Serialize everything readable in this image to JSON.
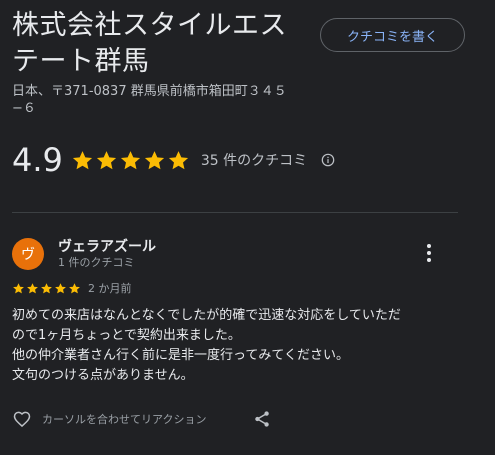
{
  "place": {
    "name_line1": "株式会社スタイルエス",
    "name_line2": "テート群馬",
    "address_line1": "日本、〒371-0837 群馬県前橋市箱田町３４５",
    "address_line2": "−６"
  },
  "write_review_button": {
    "label": "クチコミを書く"
  },
  "rating": {
    "value": "4.9",
    "stars": 5,
    "review_count_label": "35 件のクチコミ"
  },
  "review": {
    "avatar_initial": "ヴ",
    "avatar_color": "#e8710a",
    "author": "ヴェラアズール",
    "author_meta": "1 件のクチコミ",
    "stars": 5,
    "date": "2 か月前",
    "text_lines": [
      "初めての来店はなんとなくでしたが的確で迅速な対応をしていただ",
      "ので1ヶ月ちょっとで契約出来ました。",
      "他の仲介業者さん行く前に是非一度行ってみてください。",
      "文句のつける点がありません。"
    ],
    "reaction_label": "カーソルを合わせてリアクション"
  },
  "colors": {
    "background": "#202124",
    "star": "#fbbc04",
    "accent_link": "#8ab4f8"
  },
  "icons": {
    "rating_info": "info-icon",
    "review_menu": "more-vert-icon",
    "like": "heart-outline-icon",
    "share": "share-icon"
  }
}
